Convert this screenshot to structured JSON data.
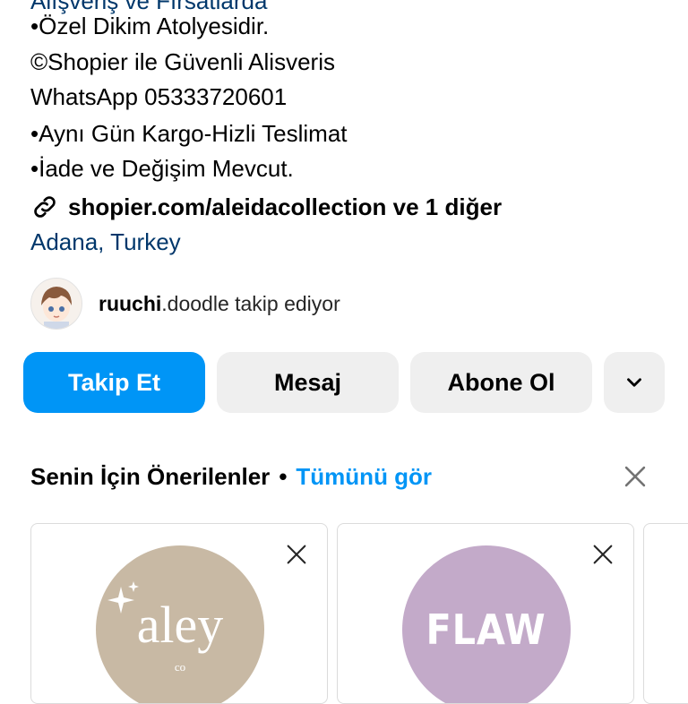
{
  "bio": {
    "cut_line": "Alışveriş ve Fırsatlarda",
    "lines": [
      "•Özel Dikim Atolyesidir.",
      "©Shopier ile Güvenli Alisveris",
      "WhatsApp 05333720601",
      "•Aynı Gün Kargo-Hizli Teslimat",
      "•İade ve Değişim Mevcut."
    ],
    "link": "shopier.com/aleidacollection ve 1 diğer",
    "location": "Adana, Turkey"
  },
  "followed_by": {
    "username": "ruuchi",
    "rest": ".doodle takip ediyor"
  },
  "actions": {
    "follow": "Takip Et",
    "message": "Mesaj",
    "subscribe": "Abone Ol"
  },
  "suggestions": {
    "title": "Senin İçin Önerilenler",
    "separator": "•",
    "see_all": "Tümünü gör",
    "cards": [
      {
        "logo_text": "aley",
        "logo_sub": "co"
      },
      {
        "logo_text": "FLAW"
      }
    ]
  },
  "colors": {
    "primary": "#0095f6",
    "secondary_button": "#efefef",
    "link_dark_blue": "#00376b",
    "card_1_bg": "#c8b9a4",
    "card_2_bg": "#c3aac9"
  }
}
